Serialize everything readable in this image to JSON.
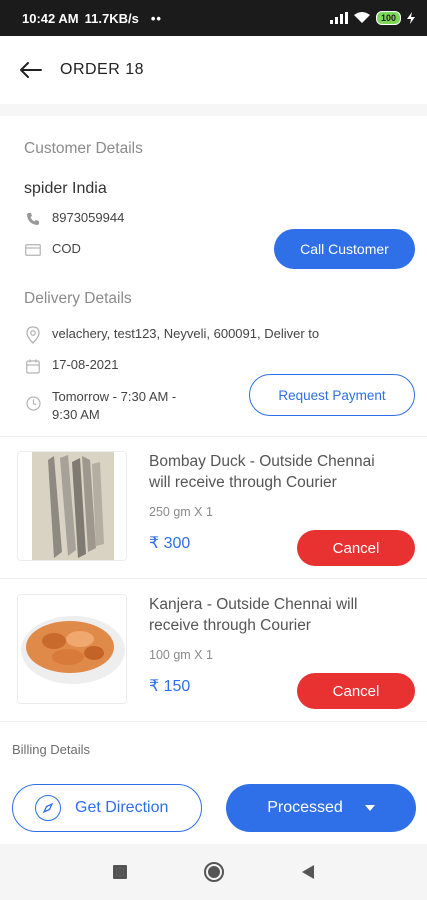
{
  "status_bar": {
    "time": "10:42 AM",
    "speed": "11.7KB/s",
    "dots": "••",
    "battery": "100"
  },
  "header": {
    "title": "ORDER 18"
  },
  "customer": {
    "section_label": "Customer Details",
    "name": "spider India",
    "phone": "8973059944",
    "payment": "COD",
    "call_button": "Call Customer"
  },
  "delivery": {
    "section_label": "Delivery Details",
    "address": "velachery, test123, Neyveli, 600091, Deliver to",
    "date": "17-08-2021",
    "slot_line1": "Tomorrow - 7:30 AM -",
    "slot_line2": "9:30 AM",
    "request_button": "Request Payment"
  },
  "products": [
    {
      "name_line1": "Bombay Duck - Outside Chennai",
      "name_line2": "will receive through Courier",
      "qty": "250 gm X 1",
      "price": "₹ 300",
      "cancel_label": "Cancel"
    },
    {
      "name_line1": "Kanjera - Outside Chennai will",
      "name_line2": "receive through Courier",
      "qty": "100 gm X 1",
      "price": "₹ 150",
      "cancel_label": "Cancel"
    }
  ],
  "billing": {
    "label": "Billing Details"
  },
  "actions": {
    "direction_label": "Get Direction",
    "processed_label": "Processed"
  },
  "colors": {
    "accent": "#2f6fe8",
    "danger": "#e83232"
  },
  "icons": [
    "back-arrow-icon",
    "phone-icon",
    "card-icon",
    "location-pin-icon",
    "calendar-icon",
    "clock-icon",
    "compass-icon",
    "chevron-down-icon",
    "nav-square-icon",
    "nav-circle-icon",
    "nav-back-triangle-icon"
  ]
}
